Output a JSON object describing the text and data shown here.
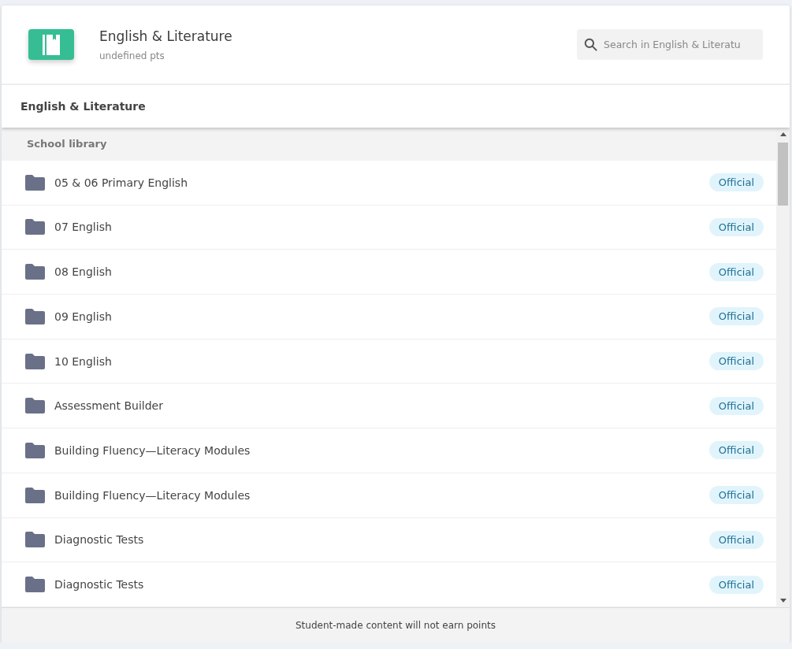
{
  "header": {
    "title": "English & Literature",
    "points": "undefined pts",
    "search": {
      "placeholder": "Search in English & Literatu"
    }
  },
  "breadcrumb": "English & Literature",
  "section": {
    "title": "School library",
    "items": [
      {
        "name": "05 & 06 Primary English",
        "badge": "Official"
      },
      {
        "name": "07 English",
        "badge": "Official"
      },
      {
        "name": "08 English",
        "badge": "Official"
      },
      {
        "name": "09 English",
        "badge": "Official"
      },
      {
        "name": "10 English",
        "badge": "Official"
      },
      {
        "name": "Assessment Builder",
        "badge": "Official"
      },
      {
        "name": "Building Fluency—Literacy Modules",
        "badge": "Official"
      },
      {
        "name": "Building Fluency—Literacy Modules",
        "badge": "Official"
      },
      {
        "name": "Diagnostic Tests",
        "badge": "Official"
      },
      {
        "name": "Diagnostic Tests",
        "badge": "Official"
      }
    ]
  },
  "footer": "Student-made content will not earn points"
}
